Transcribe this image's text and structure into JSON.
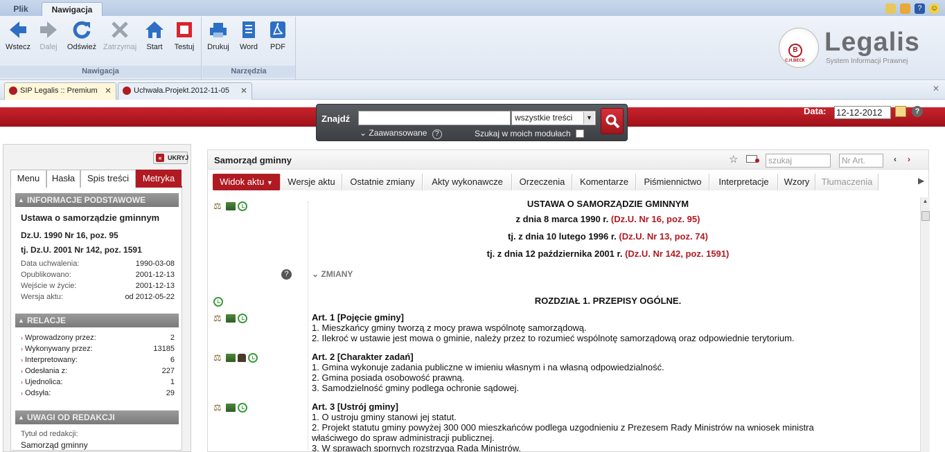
{
  "ribbon": {
    "tabs": [
      "Plik",
      "Nawigacja"
    ],
    "groups": [
      {
        "label": "Nawigacja",
        "buttons": [
          "Wstecz",
          "Dalej",
          "Odśwież",
          "Zatrzymaj",
          "Start",
          "Testuj"
        ]
      },
      {
        "label": "Narzędzia",
        "buttons": [
          "Drukuj",
          "Word",
          "PDF"
        ]
      }
    ],
    "top_icons": [
      "folder-icon",
      "folder-star-icon",
      "help-icon",
      "smiley-icon"
    ]
  },
  "logo": {
    "name": "Legalis",
    "subtitle": "System Informacji Prawnej",
    "seal_letter": "B",
    "seal_text": "C.H.BECK"
  },
  "doc_tabs": [
    {
      "label": "SIP Legalis :: Premium",
      "active": true
    },
    {
      "label": "Uchwała.Projekt.2012-11-05",
      "active": false
    }
  ],
  "search": {
    "label": "Znajdź",
    "query": "",
    "scope": "wszystkie treści",
    "advanced_label": "Zaawansowane",
    "modules_label": "Szukaj w moich modułach"
  },
  "date": {
    "label": "Data:",
    "value": "12-12-2012"
  },
  "left_panel": {
    "hide_label": "UKRYJ",
    "tabs": [
      "Menu",
      "Hasła",
      "Spis treści",
      "Metryka"
    ],
    "basic_info": {
      "header": "INFORMACJE PODSTAWOWE",
      "title": "Ustawa o samorządzie gminnym",
      "ref1": "Dz.U. 1990 Nr 16, poz. 95",
      "ref2": "tj. Dz.U. 2001 Nr 142, poz. 1591",
      "rows": [
        {
          "label": "Data uchwalenia:",
          "value": "1990-03-08"
        },
        {
          "label": "Opublikowano:",
          "value": "2001-12-13"
        },
        {
          "label": "Wejście w życie:",
          "value": "2001-12-13"
        },
        {
          "label": "Wersja aktu:",
          "value": "od 2012-05-22"
        }
      ]
    },
    "relations": {
      "header": "RELACJE",
      "rows": [
        {
          "label": "Wprowadzony przez:",
          "value": "2"
        },
        {
          "label": "Wykonywany przez:",
          "value": "13185"
        },
        {
          "label": "Interpretowany:",
          "value": "6"
        },
        {
          "label": "Odesłania z:",
          "value": "227"
        },
        {
          "label": "Ujednolica:",
          "value": "1"
        },
        {
          "label": "Odsyła:",
          "value": "29"
        }
      ]
    },
    "notes": {
      "header": "UWAGI OD REDAKCJI",
      "label": "Tytuł od redakcji:",
      "value": "Samorząd gminny"
    }
  },
  "main": {
    "title": "Samorząd gminny",
    "search_placeholder": "szukaj",
    "art_placeholder": "Nr Art.",
    "tabs": [
      "Widok aktu",
      "Wersje aktu",
      "Ostatnie zmiany",
      "Akty wykonawcze",
      "Orzeczenia",
      "Komentarze",
      "Piśmiennictwo",
      "Interpretacje",
      "Wzory",
      "Tłumaczenia"
    ],
    "document": {
      "heading": "USTAWA O SAMORZĄDZIE GMINNYM",
      "date1": "z dnia 8 marca 1990 r.",
      "ref1": "(Dz.U. Nr 16, poz. 95)",
      "date2": "tj. z dnia 10 lutego 1996 r.",
      "ref2": "(Dz.U. Nr 13, poz. 74)",
      "date3": "tj. z dnia 12 października 2001 r.",
      "ref3": "(Dz.U. Nr 142, poz. 1591)",
      "changes": "ZMIANY",
      "chapter": "ROZDZIAŁ 1. PRZEPISY OGÓLNE.",
      "articles": [
        {
          "title": "Art. 1 [Pojęcie gminy]",
          "lines": [
            "1. Mieszkańcy gminy tworzą z mocy prawa wspólnotę samorządową.",
            "2. Ilekroć w ustawie jest mowa o gminie, należy przez to rozumieć wspólnotę samorządową oraz odpowiednie terytorium."
          ]
        },
        {
          "title": "Art. 2 [Charakter zadań]",
          "lines": [
            "1. Gmina wykonuje zadania publiczne w imieniu własnym i na własną odpowiedzialność.",
            "2. Gmina posiada osobowość prawną.",
            "3. Samodzielność gminy podlega ochronie sądowej."
          ]
        },
        {
          "title": "Art. 3 [Ustrój gminy]",
          "lines": [
            "1. O ustroju gminy stanowi jej statut.",
            "2. Projekt statutu gminy powyżej 300 000 mieszkańców podlega uzgodnieniu z Prezesem Rady Ministrów na wniosek ministra",
            "właściwego do spraw administracji publicznej.",
            "3. W sprawach spornych rozstrzyga Rada Ministrów."
          ]
        }
      ]
    }
  }
}
